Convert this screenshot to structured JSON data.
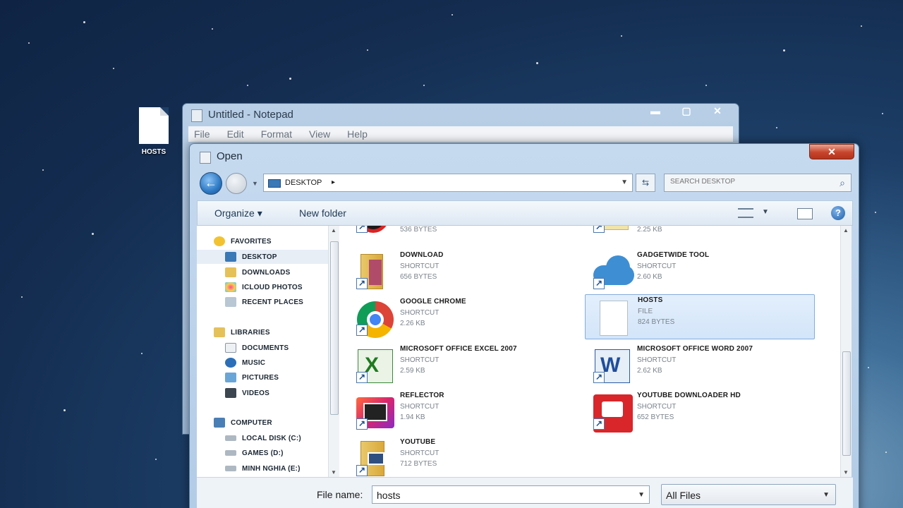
{
  "desktop": {
    "icon_label": "HOSTS"
  },
  "notepad": {
    "title": "Untitled - Notepad",
    "controls": [
      "▬",
      "▢",
      "✕"
    ],
    "menu": [
      "File",
      "Edit",
      "Format",
      "View",
      "Help"
    ]
  },
  "dialog": {
    "title": "Open",
    "close": "✕",
    "address": {
      "crumb": "DESKTOP",
      "arrow": "▸"
    },
    "search_placeholder": "SEARCH DESKTOP",
    "toolbar": {
      "organize": "Organize ▾",
      "new_folder": "New folder",
      "help": "?"
    },
    "nav": {
      "favorites": "FAVORITES",
      "desktop": "DESKTOP",
      "downloads": "DOWNLOADS",
      "icloud": "ICLOUD PHOTOS",
      "recent": "RECENT PLACES",
      "libraries": "LIBRARIES",
      "documents": "DOCUMENTS",
      "music": "MUSIC",
      "pictures": "PICTURES",
      "videos": "VIDEOS",
      "computer": "COMPUTER",
      "local_disk": "LOCAL DISK (C:)",
      "games": "GAMES (D:)",
      "minh": "MINH NGHIA (E:)"
    },
    "files": {
      "top_left": {
        "size": "536 BYTES"
      },
      "top_right": {
        "size": "2.25 KB"
      },
      "download": {
        "name": "DOWNLOAD",
        "type": "SHORTCUT",
        "size": "656 BYTES"
      },
      "gadget": {
        "name": "GADGETWIDE TOOL",
        "type": "SHORTCUT",
        "size": "2.60 KB"
      },
      "chrome": {
        "name": "GOOGLE CHROME",
        "type": "SHORTCUT",
        "size": "2.26 KB"
      },
      "hosts": {
        "name": "HOSTS",
        "type": "FILE",
        "size": "824 BYTES"
      },
      "excel": {
        "name": "MICROSOFT OFFICE EXCEL 2007",
        "type": "SHORTCUT",
        "size": "2.59 KB"
      },
      "word": {
        "name": "MICROSOFT OFFICE WORD 2007",
        "type": "SHORTCUT",
        "size": "2.62 KB"
      },
      "reflector": {
        "name": "REFLECTOR",
        "type": "SHORTCUT",
        "size": "1.94 KB"
      },
      "ytdl": {
        "name": "YOUTUBE DOWNLOADER HD",
        "type": "SHORTCUT",
        "size": "652 BYTES"
      },
      "youtube": {
        "name": "YOUTUBE",
        "type": "SHORTCUT",
        "size": "712 BYTES"
      }
    },
    "footer": {
      "file_name_label": "File name:",
      "file_name_value": "hosts",
      "file_type": "All Files"
    }
  }
}
